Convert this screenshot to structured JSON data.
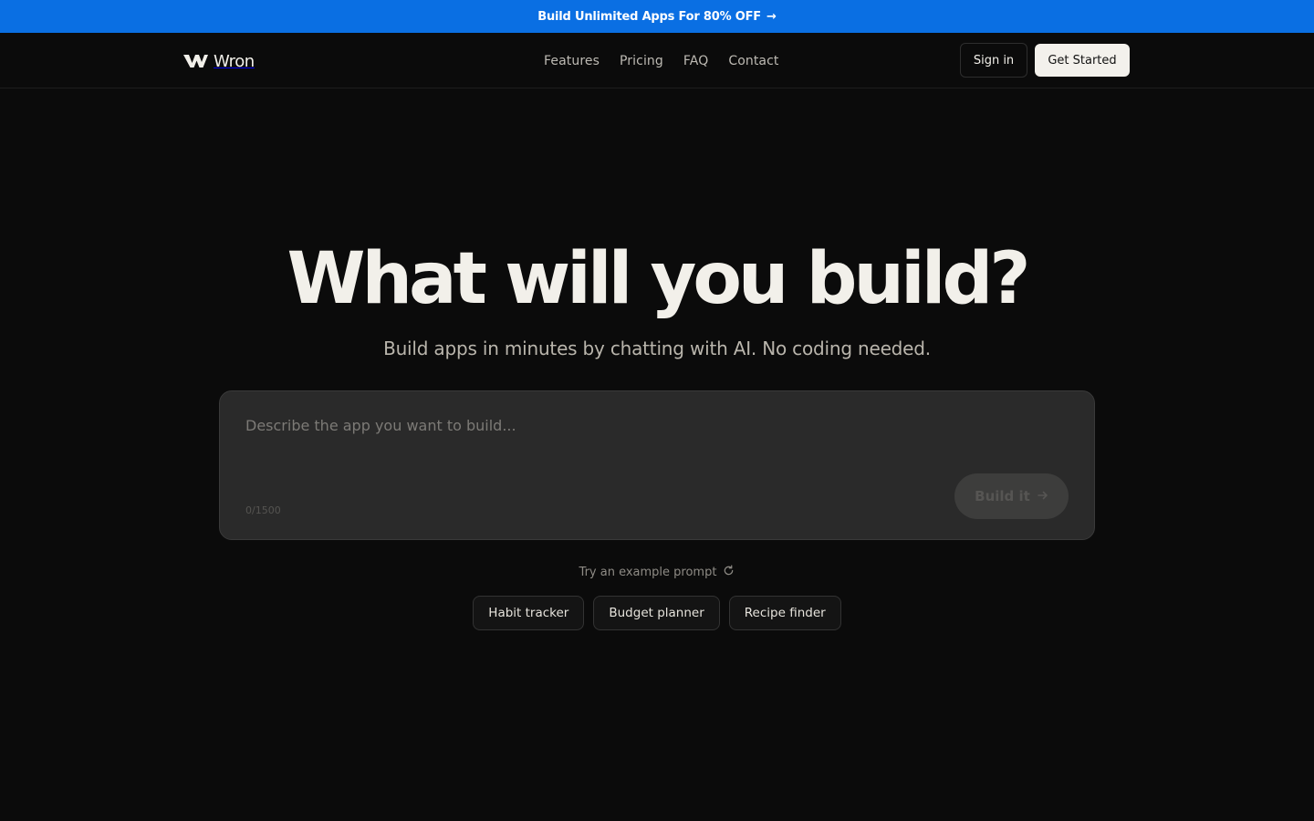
{
  "promo": {
    "text": "Build Unlimited Apps For 80% OFF",
    "arrow": "→"
  },
  "brand": {
    "name": "Wron",
    "logo_icon": "w-logo-icon"
  },
  "nav": {
    "links": [
      "Features",
      "Pricing",
      "FAQ",
      "Contact"
    ],
    "signin_label": "Sign in",
    "cta_label": "Get Started"
  },
  "hero": {
    "title": "What will you build?",
    "subtitle": "Build apps in minutes by chatting with AI. No coding needed."
  },
  "prompt": {
    "placeholder": "Describe the app you want to build...",
    "value": "",
    "counter": "0/1500",
    "build_label": "Build it",
    "build_icon": "arrow-right-icon"
  },
  "examples": {
    "label": "Try an example prompt",
    "refresh_icon": "refresh-icon",
    "chips": [
      "Habit tracker",
      "Budget planner",
      "Recipe finder"
    ]
  },
  "colors": {
    "promo_bg": "#0a6fe3",
    "page_bg": "#0b0b0b",
    "text": "#f2f0ea",
    "cta_bg": "#f3f1ec"
  }
}
